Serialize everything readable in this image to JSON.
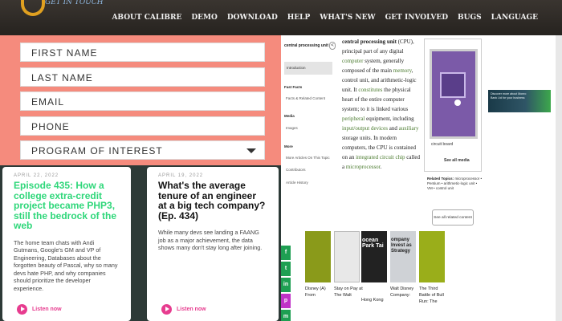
{
  "header": {
    "logo_text": "GET IN TOUCH",
    "nav": [
      "About Calibre",
      "Demo",
      "Download",
      "Help",
      "What's New",
      "Get Involved",
      "Bugs",
      "Language"
    ]
  },
  "form": {
    "fields": [
      "FIRST NAME",
      "LAST NAME",
      "EMAIL",
      "PHONE",
      "PROGRAM OF INTEREST"
    ]
  },
  "podcasts": [
    {
      "date": "APRIL 22, 2022",
      "title": "Episode 435: How a college extra-credit project became PHP3, still the bedrock of the web",
      "description": "The home team chats with Andi Gutmans, Google's GM and VP of Engineering, Databases about the forgotten beauty of Pascal, why so many devs hate PHP, and why companies should prioritize the developer experience.",
      "listen": "Listen now",
      "color": "#2fd77a"
    },
    {
      "date": "APRIL 19, 2022",
      "title": "What's the average tenure of an engineer at a big tech company? (Ep. 434)",
      "description": "While many devs see landing a FAANG job as a major achievement, the data shows many don't stay long after joining.",
      "listen": "Listen now",
      "color": "#111111"
    }
  ],
  "wiki": {
    "title": "central processing unit",
    "back": "<",
    "intro": "Introduction",
    "sections": [
      {
        "heading": "Fast Facts",
        "links": [
          "Facts & Related Content"
        ]
      },
      {
        "heading": "Media",
        "links": [
          "Images"
        ]
      },
      {
        "heading": "More",
        "links": [
          "More Articles On This Topic",
          "Contributors",
          "Article History"
        ]
      }
    ],
    "article": [
      {
        "text": "central processing unit",
        "bold": true
      },
      {
        "text": " (CPU), principal part of any digital "
      },
      {
        "text": "computer",
        "link": true
      },
      {
        "text": " system, generally composed of the main "
      },
      {
        "text": "memory",
        "link": true
      },
      {
        "text": ", control unit, and arithmetic-logic unit. It "
      },
      {
        "text": "constitutes",
        "link": true
      },
      {
        "text": " the physical heart of the entire computer system; to it is linked various "
      },
      {
        "text": "peripheral",
        "link": true
      },
      {
        "text": " equipment, including "
      },
      {
        "text": "input/output devices",
        "link": true
      },
      {
        "text": " and "
      },
      {
        "text": "auxiliary",
        "link": true
      },
      {
        "text": " storage units. In modern computers, the CPU is contained on an "
      },
      {
        "text": "integrated circuit chip",
        "link": true
      },
      {
        "text": " called a "
      },
      {
        "text": "microprocessor",
        "link": true
      },
      {
        "text": "."
      }
    ],
    "figure_caption": "circuit board",
    "see_all_media": "See all media",
    "related_heading": "Related Topics:",
    "related_text": " microprocessor • Pentium • arithmetic-logic unit • VM • control unit",
    "see_all_related": "See all related content →",
    "ad_text": "Discover more about Monro Bank Ltd for your business"
  },
  "books": [
    {
      "title": "Disney (A) From",
      "cover": "#8a9a1a"
    },
    {
      "title": "Stay on Pay at The Walt",
      "cover": "#e8e8e8"
    },
    {
      "title": "Hong Kong",
      "cover": "#222222",
      "overlay": "ocean Park Tai"
    },
    {
      "title": "Walt Disney Company:",
      "cover": "#cfd2d6",
      "overlay": "ompany Invest as Strategy"
    },
    {
      "title": "The Third Battle of Bull Run: The",
      "cover": "#9aae1a"
    }
  ],
  "share": [
    {
      "icon": "f",
      "color": "#1e9f52"
    },
    {
      "icon": "t",
      "color": "#1e9f52"
    },
    {
      "icon": "in",
      "color": "#1e9f52"
    },
    {
      "icon": "p",
      "color": "#c033c7"
    },
    {
      "icon": "m",
      "color": "#1e9f52"
    }
  ]
}
